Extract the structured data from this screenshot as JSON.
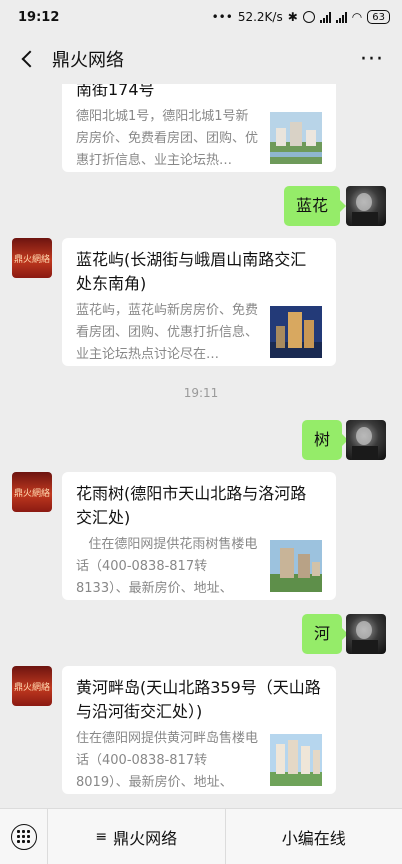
{
  "status": {
    "time": "19:12",
    "net_speed": "52.2K/s",
    "network_1": "4G",
    "network_2": "4G",
    "battery": "63"
  },
  "nav": {
    "title": "鼎火网络"
  },
  "messages": [
    {
      "type": "card",
      "title": "南街174号",
      "description": "德阳北城1号，德阳北城1号新房房价、免费看房团、团购、优惠打折信息、业主论坛热…"
    },
    {
      "type": "text",
      "text": "蓝花"
    },
    {
      "type": "card",
      "title": "蓝花屿(长湖街与峨眉山南路交汇处东南角)",
      "description": "蓝花屿，蓝花屿新房房价、免费看房团、团购、优惠打折信息、业主论坛热点讨论尽在…"
    },
    {
      "type": "time",
      "text": "19:11"
    },
    {
      "type": "text",
      "text": "树"
    },
    {
      "type": "card",
      "title": "花雨树(德阳市天山北路与洛河路交汇处)",
      "description": "   住在德阳网提供花雨树售楼电话（400-0838-817转8133）、最新房价、地址、交…"
    },
    {
      "type": "text",
      "text": "河"
    },
    {
      "type": "card",
      "title": "黄河畔岛(天山北路359号（天山路与沿河街交汇处）)",
      "description": "住在德阳网提供黄河畔岛售楼电话（400-0838-817转8019）、最新房价、地址、交…"
    }
  ],
  "bot_avatar_text": "鼎火網絡",
  "bottom_menu": {
    "item1": "鼎火网络",
    "item2": "小编在线"
  },
  "colors": {
    "chat_bg": "#ededed",
    "bubble_green": "#95ec69",
    "card_bg": "#ffffff",
    "desc_gray": "#888888"
  }
}
